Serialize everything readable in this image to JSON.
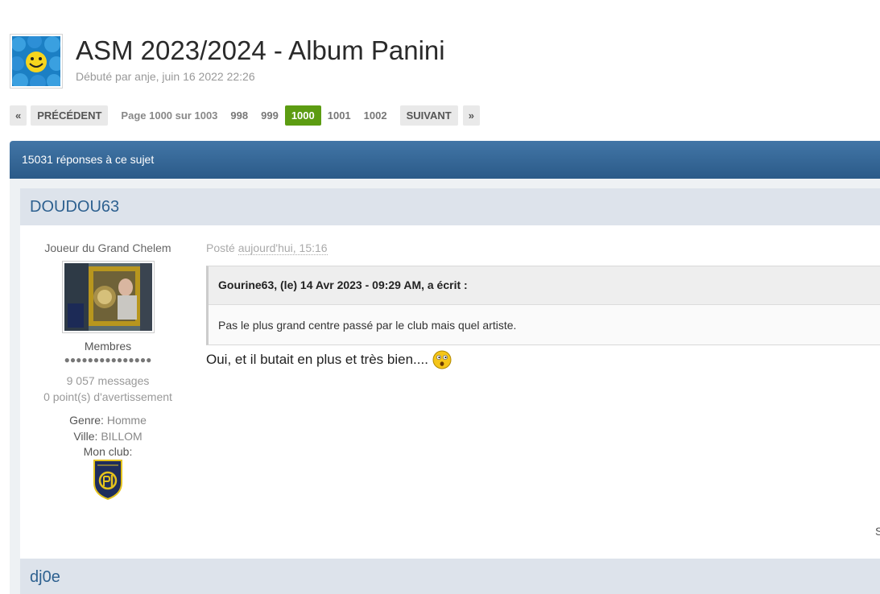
{
  "topic": {
    "title": "ASM 2023/2024 - Album Panini",
    "meta": "Débuté par anje, juin 16 2022 22:26",
    "avatar_icon": "smiley-crowd-avatar"
  },
  "pagination": {
    "first": "«",
    "prev": "PRÉCÉDENT",
    "info": "Page 1000 sur 1003",
    "pages": [
      "998",
      "999",
      "1000",
      "1001",
      "1002"
    ],
    "current": "1000",
    "next": "SUIVANT",
    "last": "»"
  },
  "replies_bar": {
    "text": "15031 réponses à ce sujet"
  },
  "post": {
    "author": "DOUDOU63",
    "rank": "Joueur du Grand Chelem",
    "group": "Membres",
    "pips": "●●●●●●●●●●●●●●●",
    "messages": "9 057 messages",
    "warnings": "0 point(s) d'avertissement",
    "gender_label": "Genre:",
    "gender_value": "Homme",
    "city_label": "Ville:",
    "city_value": "BILLOM",
    "club_label": "Mon club:",
    "club_logo": "asm-clermont-logo",
    "posted_prefix": "Posté",
    "posted_time": "aujourd'hui, 15:16",
    "quote_header": "Gourine63, (le) 14 Avr 2023 - 09:29 AM, a écrit :",
    "quote_text": "Pas le plus grand centre passé par le club mais quel artiste.",
    "body_text": "Oui, et il butait en plus et très bien....",
    "emoticon": "wondering-smiley-icon",
    "edge_text": "S"
  },
  "next_post": {
    "author": "dj0e"
  },
  "colors": {
    "bar": "#2b5a88",
    "current_page": "#5c9c12",
    "author_link": "#2e6190"
  }
}
